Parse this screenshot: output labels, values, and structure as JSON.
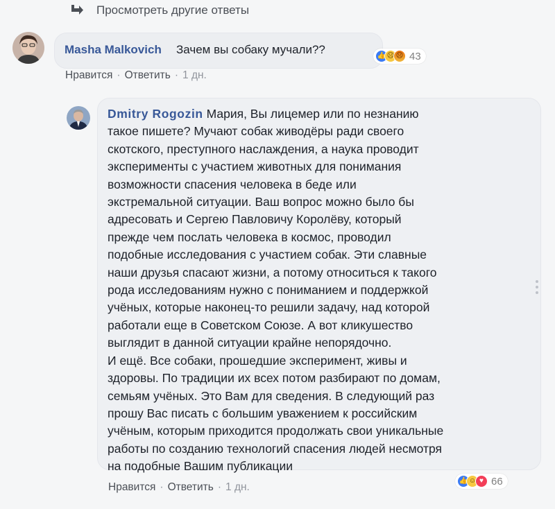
{
  "more_replies": {
    "label": "Просмотреть другие ответы"
  },
  "comments": [
    {
      "author": "Masha Malkovich",
      "text": "Зачем вы собаку мучали??",
      "reactions": {
        "icons": [
          "like-icon",
          "sad-icon",
          "angry-icon"
        ],
        "count": "43"
      },
      "actions": {
        "like": "Нравится",
        "reply": "Ответить",
        "time": "1 дн."
      }
    },
    {
      "author": "Dmitry Rogozin",
      "text": "Мария, Вы лицемер или по незнанию\nтакое пишете? Мучают собак живодёры ради своего\nскотского, преступного наслаждения, а наука проводит\nэксперименты с участием животных для понимания\nвозможности спасения человека в беде или\nэкстремальной ситуации. Ваш вопрос можно было бы\nадресовать и Сергею Павловичу Королёву, который\nпрежде чем послать человека в космос, проводил\nподобные исследования с участием собак. Эти славные\nнаши друзья спасают жизни, а потому относиться к такого\nрода исследованиям нужно с пониманием и поддержкой\nучёных, которые наконец-то решили задачу, над которой\nработали еще в Советском Союзе. А вот кликушество\nвыглядит в данной ситуации крайне непорядочно.\nИ ещё. Все собаки, прошедшие эксперимент, живы и\nздоровы. По традиции их всех потом разбирают по домам,\nсемьям учёных. Это Вам для сведения. В следующий раз\nпрошу Вас писать с большим уважением к российским\nучёным, которым приходится продолжать свои уникальные\nработы по созданию технологий спасения людей несмотря\nна подобные Вашим публикации",
      "reactions": {
        "icons": [
          "like-icon",
          "haha-icon",
          "love-icon"
        ],
        "count": "66"
      },
      "actions": {
        "like": "Нравится",
        "reply": "Ответить",
        "time": "1 дн."
      }
    }
  ],
  "colors": {
    "author": "#385898",
    "page_bg": "#f5f6f7",
    "bubble_bg": "#eef0f3",
    "meta": "#4b4f56"
  }
}
